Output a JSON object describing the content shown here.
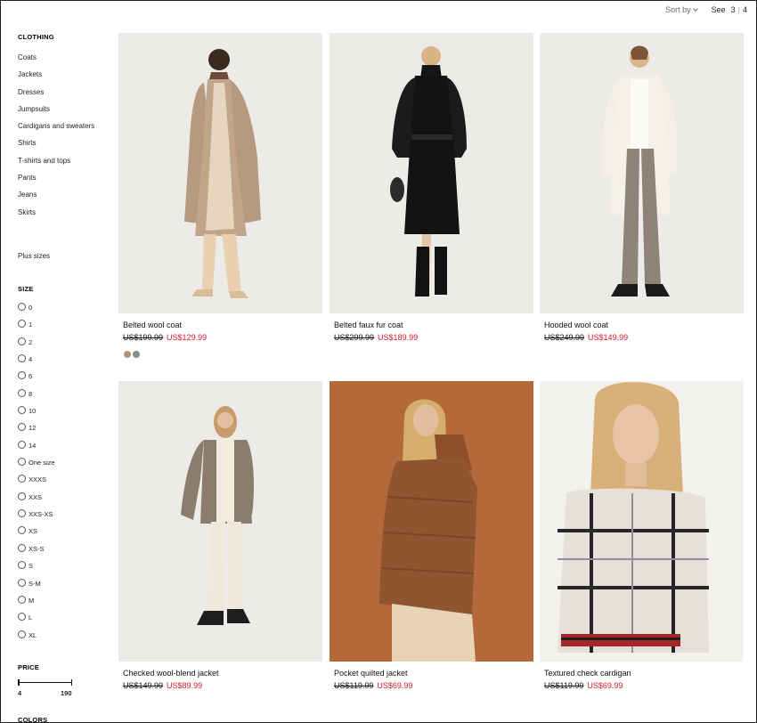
{
  "toolbar": {
    "sort_label": "Sort by",
    "see_label": "See",
    "view_options": [
      "3",
      "4"
    ],
    "separator": "|"
  },
  "sidebar": {
    "clothing_title": "CLOTHING",
    "categories": [
      "Coats",
      "Jackets",
      "Dresses",
      "Jumpsuits",
      "Cardigans and sweaters",
      "Shirts",
      "T-shirts and tops",
      "Pants",
      "Jeans",
      "Skirts"
    ],
    "plus_sizes": "Plus sizes",
    "size_title": "SIZE",
    "sizes": [
      "0",
      "1",
      "2",
      "4",
      "6",
      "8",
      "10",
      "12",
      "14",
      "One size",
      "XXXS",
      "XXS",
      "XXS-XS",
      "XS",
      "XS-S",
      "S",
      "S-M",
      "M",
      "L",
      "XL"
    ],
    "price_title": "PRICE",
    "price_min": "4",
    "price_max": "190",
    "colors_title": "COLORS"
  },
  "products": [
    {
      "name": "Belted wool coat",
      "old_price": "US$199.99",
      "new_price": "US$129.99",
      "swatches": [
        "#b09478",
        "#8a8a8a"
      ]
    },
    {
      "name": "Belted faux fur coat",
      "old_price": "US$299.99",
      "new_price": "US$189.99"
    },
    {
      "name": "Hooded wool coat",
      "old_price": "US$249.99",
      "new_price": "US$149.99"
    },
    {
      "name": "Checked wool-blend jacket",
      "old_price": "US$149.99",
      "new_price": "US$89.99"
    },
    {
      "name": "Pocket quilted jacket",
      "old_price": "US$119.99",
      "new_price": "US$69.99"
    },
    {
      "name": "Textured check cardigan",
      "old_price": "US$119.99",
      "new_price": "US$69.99"
    }
  ],
  "colors": {
    "sale_red": "#d11a2a",
    "photo_bg": "#ecebe8",
    "rust_bg": "#b4693a"
  }
}
